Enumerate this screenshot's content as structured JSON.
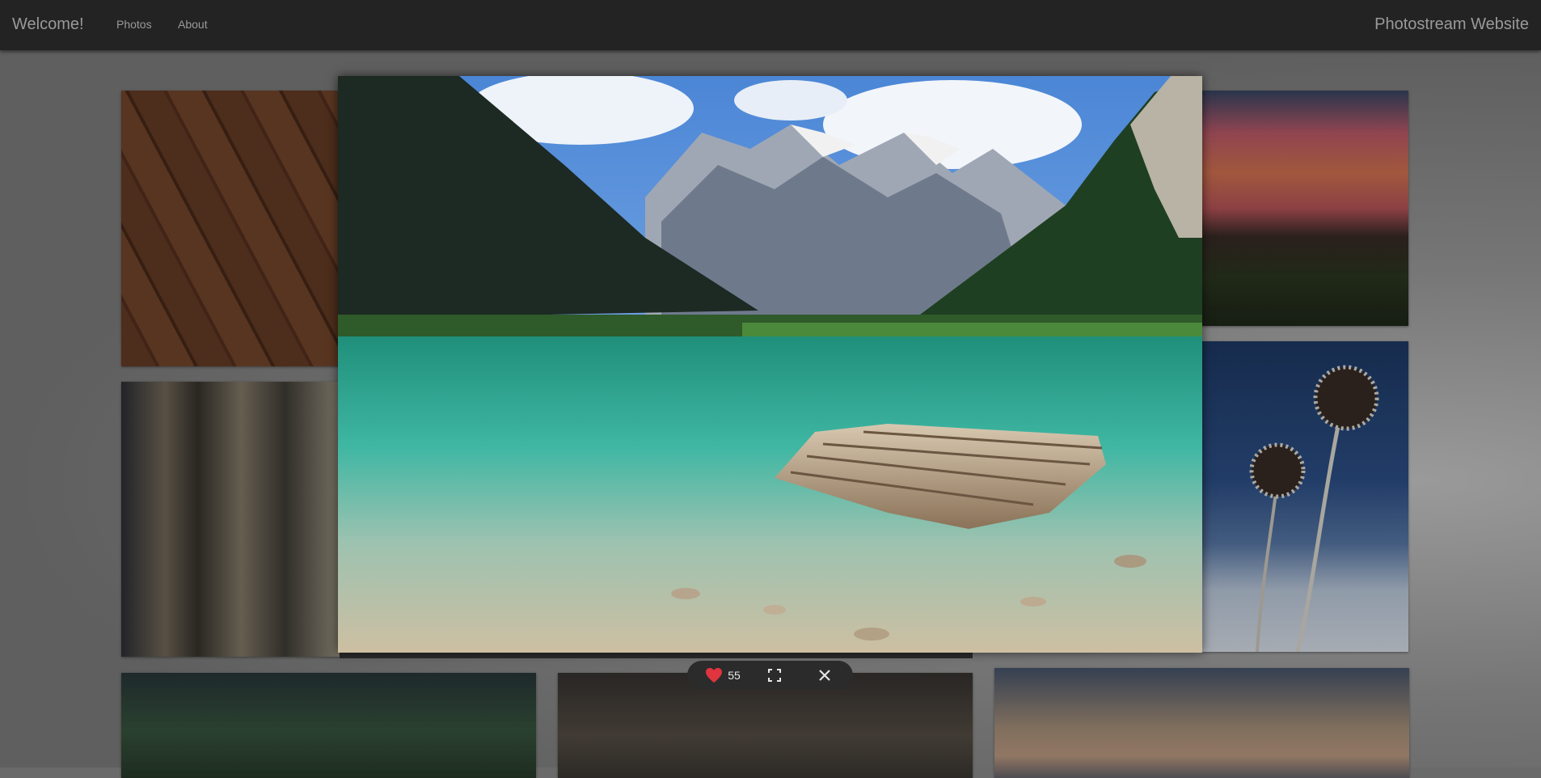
{
  "navbar": {
    "brand": "Welcome!",
    "links": [
      {
        "label": "Photos"
      },
      {
        "label": "About"
      }
    ],
    "site_title": "Photostream Website"
  },
  "lightbox": {
    "likes": "55",
    "icons": {
      "like": "heart-icon",
      "fullscreen": "fullscreen-icon",
      "close": "close-icon"
    },
    "colors": {
      "heart": "#e0343f",
      "toolbar_bg": "#2b2b2b"
    }
  },
  "gallery": {
    "photos": [
      {
        "subject": "brick-wall"
      },
      {
        "subject": "industrial-building"
      },
      {
        "subject": "sunset-field"
      },
      {
        "subject": "frosted-thistle"
      },
      {
        "subject": "forest"
      },
      {
        "subject": "night-tree"
      },
      {
        "subject": "dusk-lake"
      }
    ]
  }
}
